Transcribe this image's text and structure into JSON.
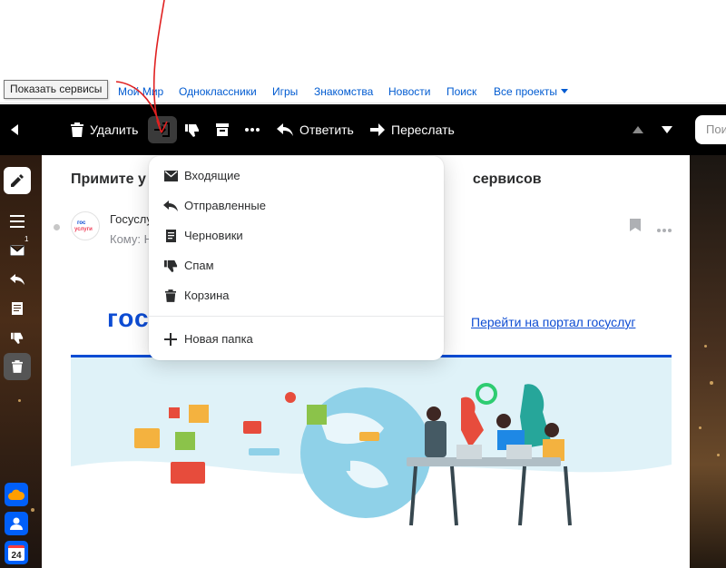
{
  "tooltip": "Показать сервисы",
  "portal_nav": {
    "links": [
      "Мой Мир",
      "Одноклассники",
      "Игры",
      "Знакомства",
      "Новости",
      "Поиск",
      "Все проекты"
    ]
  },
  "toolbar": {
    "delete_label": "Удалить",
    "reply_label": "Ответить",
    "forward_label": "Переслать",
    "search_placeholder": "Поис"
  },
  "sidebar": {
    "inbox_badge": "1",
    "calendar_day": "24"
  },
  "email": {
    "subject_start": "Примите у",
    "subject_end": "сервисов",
    "sender": "Госуслу",
    "recipient": "Кому: Н",
    "logo_text": "гос",
    "logo_badge_top": "гос",
    "logo_badge_bottom": "услуги",
    "portal_link": "Перейти на портал госуслуг"
  },
  "folder_menu": {
    "items": [
      {
        "label": "Входящие",
        "icon": "inbox-icon"
      },
      {
        "label": "Отправленные",
        "icon": "sent-icon"
      },
      {
        "label": "Черновики",
        "icon": "drafts-icon"
      },
      {
        "label": "Спам",
        "icon": "spam-icon"
      },
      {
        "label": "Корзина",
        "icon": "trash-icon"
      }
    ],
    "new_folder": "Новая папка"
  },
  "colors": {
    "toolbar_bg": "#000000",
    "link_blue": "#005bd1",
    "gos_blue": "#0d4cd3",
    "annotation_red": "#e02020"
  }
}
